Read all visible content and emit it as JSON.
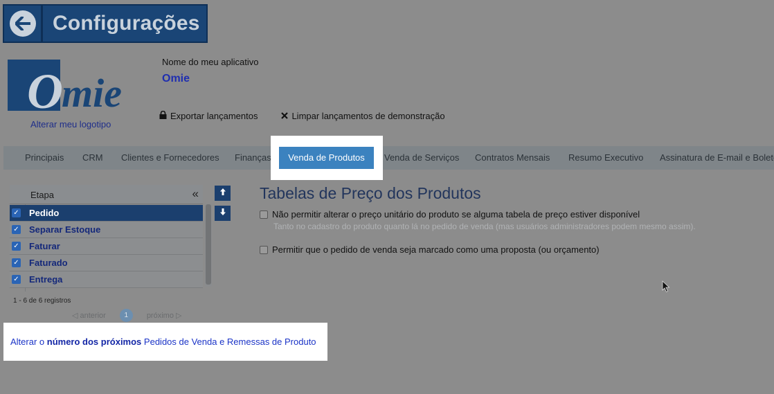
{
  "header": {
    "title": "Configurações",
    "back_icon": "arrow-left-icon"
  },
  "logo": {
    "text": "Omie",
    "change_label": "Alterar meu logotipo"
  },
  "app": {
    "name_label": "Nome do meu aplicativo",
    "name_value": "Omie"
  },
  "actions": {
    "export_label": "Exportar lançamentos",
    "clear_label": "Limpar lançamentos de demonstração"
  },
  "tabs": [
    {
      "label": "Principais"
    },
    {
      "label": "CRM"
    },
    {
      "label": "Clientes e Fornecedores"
    },
    {
      "label": "Finanças"
    },
    {
      "label": "Venda de Produtos"
    },
    {
      "label": "Venda de Serviços"
    },
    {
      "label": "Contratos Mensais"
    },
    {
      "label": "Resumo Executivo"
    },
    {
      "label": "Assinatura de E-mail e Boleto"
    }
  ],
  "grid": {
    "column": "Etapa",
    "collapse_glyph": "«",
    "rows": [
      {
        "label": "Pedido",
        "checked": true,
        "selected": true
      },
      {
        "label": "Separar Estoque",
        "checked": true,
        "selected": false
      },
      {
        "label": "Faturar",
        "checked": true,
        "selected": false
      },
      {
        "label": "Faturado",
        "checked": true,
        "selected": false
      },
      {
        "label": "Entrega",
        "checked": true,
        "selected": false
      }
    ],
    "info": "1 - 6 de 6 registros",
    "pager": {
      "prev": "anterior",
      "page": "1",
      "next": "próximo"
    }
  },
  "section": {
    "title": "Tabelas de Preço dos Produtos",
    "option1": "Não permitir alterar o preço unitário do produto se alguma tabela de preço estiver disponível",
    "option1_hint": "Tanto no cadastro do produto quanto lá no pedido de venda (mas usuários administradores podem mesmo assim).",
    "option2": "Permitir que o pedido de venda seja marcado como uma proposta (ou orçamento)"
  },
  "link": {
    "prefix": "Alterar o",
    "bold": "número dos próximos",
    "suffix": "Pedidos de Venda e Remessas de Produto"
  },
  "colors": {
    "header_bg": "#1a4576",
    "active_tab": "#3b82bf",
    "link": "#1a33c7",
    "overlay": "#8c8c8c"
  }
}
